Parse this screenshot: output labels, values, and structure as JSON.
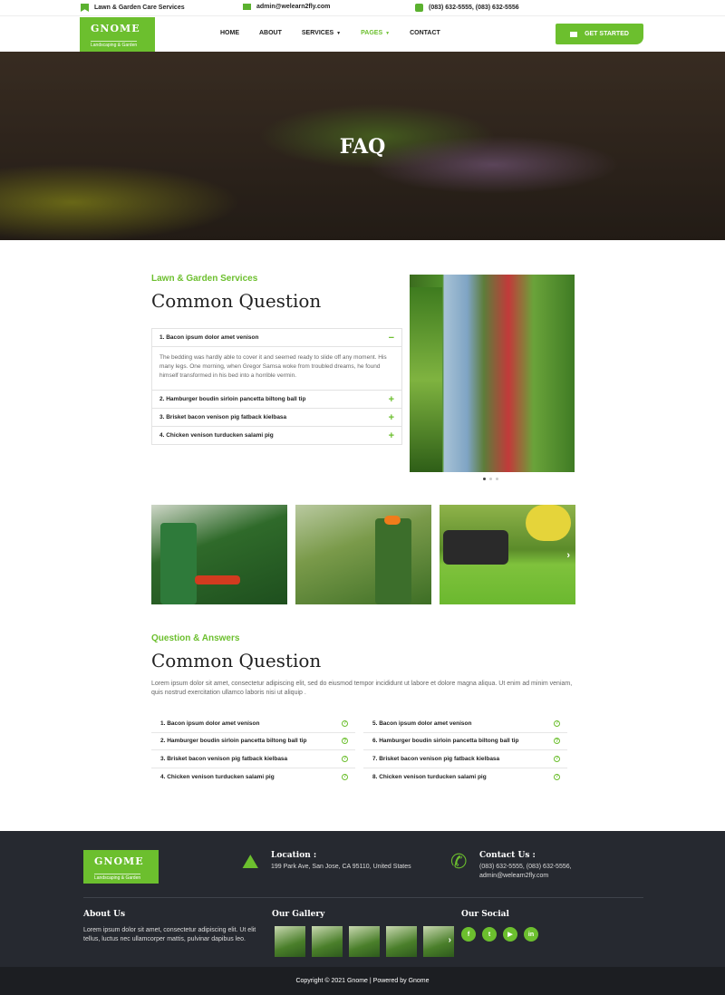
{
  "topbar": {
    "tagline": "Lawn & Garden Care Services",
    "email": "admin@welearn2fly.com",
    "phone": "(083) 632-5555, (083) 632-5556"
  },
  "header": {
    "logo_name": "GNOME",
    "logo_tag": "Landscaping & Garden",
    "nav": [
      "HOME",
      "ABOUT",
      "SERVICES",
      "PAGES",
      "CONTACT"
    ],
    "active_nav": "PAGES",
    "cta_label": "GET STARTED"
  },
  "hero": {
    "title": "FAQ"
  },
  "faq_section": {
    "eyebrow": "Lawn & Garden Services",
    "title": "Common Question",
    "items": [
      {
        "question": "1. Bacon ipsum dolor amet venison",
        "open": true,
        "answer": "The bedding was hardly able to cover it and seemed ready to slide off any moment. His many legs. One morning, when Gregor Samsa woke from troubled dreams, he found himself transformed in his bed into a horrible vermin."
      },
      {
        "question": "2. Hamburger boudin sirloin pancetta biltong ball tip",
        "open": false
      },
      {
        "question": "3. Brisket bacon venison pig fatback kielbasa",
        "open": false
      },
      {
        "question": "4. Chicken venison turducken salami pig",
        "open": false
      }
    ],
    "open_symbol": "−",
    "closed_symbol": "+",
    "slider_dots": 3,
    "slider_active": 0
  },
  "gallery": {
    "arrow": "›"
  },
  "qa_section": {
    "eyebrow": "Question & Answers",
    "title": "Common Question",
    "intro": "Lorem ipsum dolor sit amet, consectetur adipiscing elit, sed do eiusmod tempor incididunt ut labore et dolore magna aliqua. Ut enim ad minim veniam, quis nostrud exercitation ullamco laboris nisi ut aliquip .",
    "left": [
      "1. Bacon ipsum dolor amet venison",
      "2. Hamburger boudin sirloin pancetta biltong ball tip",
      "3. Brisket bacon venison pig fatback kielbasa",
      "4. Chicken venison turducken salami pig"
    ],
    "right": [
      "5. Bacon ipsum dolor amet venison",
      "6. Hamburger boudin sirloin pancetta biltong ball tip",
      "7. Brisket bacon venison pig fatback kielbasa",
      "8. Chicken venison turducken salami pig"
    ],
    "qmark": "?"
  },
  "footer": {
    "logo_name": "GNOME",
    "logo_tag": "Landscaping & Garden",
    "location_title": "Location :",
    "location_text": "199 Park Ave, San Jose, CA 95110, United States",
    "contact_title": "Contact Us :",
    "contact_phone": "(083) 632-5555, (083) 632-5556,",
    "contact_email": "admin@welearn2fly.com",
    "about_title": "About Us",
    "about_text": "Lorem ipsum dolor sit amet, consectetur adipiscing elit. Ut elit tellus, luctus nec ullamcorper mattis, pulvinar dapibus leo.",
    "gallery_title": "Our Gallery",
    "social_title": "Our Social",
    "social": [
      "f",
      "t",
      "▶",
      "in"
    ],
    "copyright": "Copyright © 2021 Gnome | Powered by Gnome"
  },
  "colors": {
    "accent": "#6cbf2e",
    "footer_bg": "#262930",
    "copyright_bg": "#1c1e22"
  }
}
